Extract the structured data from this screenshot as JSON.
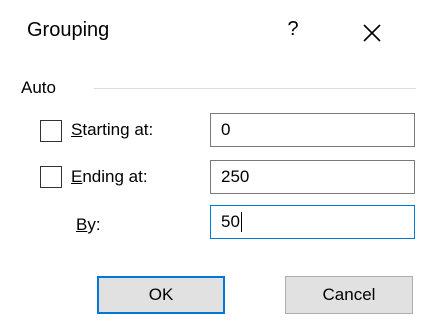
{
  "dialog": {
    "title": "Grouping",
    "help_label": "?",
    "close_icon": "close-icon"
  },
  "auto_group": {
    "label": "Auto",
    "starting_at": {
      "mnemonic": "S",
      "rest": "tarting at:",
      "checked": false,
      "value": "0"
    },
    "ending_at": {
      "mnemonic": "E",
      "rest": "nding at:",
      "checked": false,
      "value": "250"
    },
    "by": {
      "mnemonic": "B",
      "rest": "y:",
      "value": "50"
    }
  },
  "buttons": {
    "ok_label": "OK",
    "cancel_label": "Cancel"
  },
  "colors": {
    "accent": "#0078d7",
    "button_face": "#e1e1e1"
  }
}
